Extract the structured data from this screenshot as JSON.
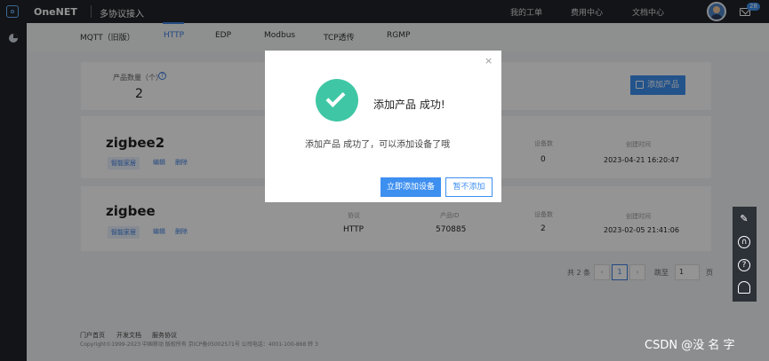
{
  "topbar": {
    "brand": "OneNET",
    "product": "多协议接入",
    "links": [
      "我的工单",
      "费用中心",
      "文档中心"
    ],
    "mail_badge": "28"
  },
  "tabs": [
    "MQTT（旧版）",
    "HTTP",
    "EDP",
    "Modbus",
    "TCP透传",
    "RGMP"
  ],
  "summary": {
    "count_label": "产品数量（个）",
    "help": "?",
    "count": "2",
    "add_button": "添加产品"
  },
  "products": [
    {
      "name": "zigbee2",
      "tag": "智能家居",
      "edit": "编辑",
      "delete": "删除",
      "device_label": "设备数",
      "devices": "0",
      "time_label": "创建时间",
      "time": "2023-04-21 16:20:47"
    },
    {
      "name": "zigbee",
      "tag": "智能家居",
      "edit": "编辑",
      "delete": "删除",
      "protocol_label": "协议",
      "protocol": "HTTP",
      "pid_label": "产品ID",
      "pid": "570885",
      "device_label": "设备数",
      "devices": "2",
      "time_label": "创建时间",
      "time": "2023-02-05 21:41:06"
    }
  ],
  "pagination": {
    "total": "共 2 条",
    "prev": "‹",
    "page": "1",
    "next": "›",
    "goto": "跳至",
    "goto_value": "1",
    "unit": "页"
  },
  "footer": {
    "links": [
      "门户首页",
      "开发文档",
      "服务协议"
    ],
    "copyright": "Copyright©1999-2023 中国移动 版权所有 京ICP备05002571号 公司电话：4001-100-868 转 3"
  },
  "modal": {
    "close": "×",
    "title": "添加产品 成功!",
    "message": "添加产品 成功了，可以添加设备了哦",
    "confirm": "立即添加设备",
    "cancel": "暂不添加"
  },
  "toolbar": {
    "icons": [
      "edit-icon",
      "headset-icon",
      "help-icon",
      "user-service-icon"
    ],
    "help_glyph": "?"
  },
  "watermark": "CSDN @没 名 字",
  "colors": {
    "accent": "#3d8ff0",
    "success": "#3fc7a5",
    "topbar": "#1f2329"
  }
}
